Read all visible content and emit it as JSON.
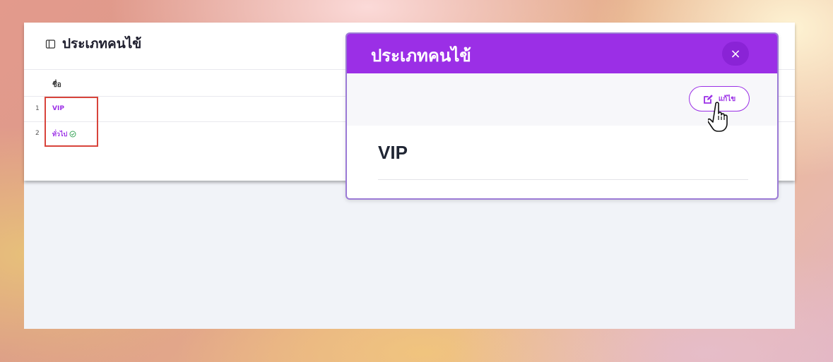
{
  "page": {
    "title": "ประเภทคนไข้",
    "title_icon": "panel-icon"
  },
  "table": {
    "columns": [
      "ชื่อ"
    ],
    "rows": [
      {
        "index": "1",
        "name": "VIP",
        "default": false
      },
      {
        "index": "2",
        "name": "ทั่วไป",
        "default": true,
        "badge_icon": "check-circle-icon"
      }
    ]
  },
  "modal": {
    "title": "ประเภทคนไข้",
    "close_label": "×",
    "edit_label": "แก้ไข",
    "edit_icon": "edit-icon",
    "record_name": "VIP"
  },
  "colors": {
    "accent": "#9b2fe6",
    "highlight": "#d8443b"
  }
}
